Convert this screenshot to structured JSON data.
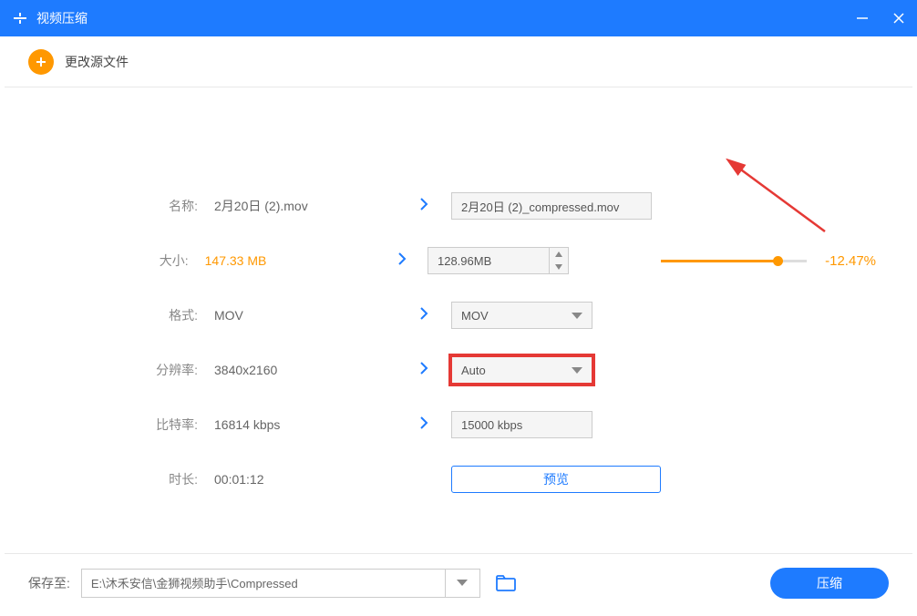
{
  "titlebar": {
    "title": "视频压缩"
  },
  "header": {
    "changeSource": "更改源文件"
  },
  "rows": {
    "name": {
      "label": "名称:",
      "source": "2月20日 (2).mov",
      "target": "2月20日 (2)_compressed.mov"
    },
    "size": {
      "label": "大小:",
      "source": "147.33 MB",
      "target": "128.96MB",
      "percent": "-12.47%"
    },
    "format": {
      "label": "格式:",
      "source": "MOV",
      "target": "MOV"
    },
    "resolution": {
      "label": "分辨率:",
      "source": "3840x2160",
      "target": "Auto"
    },
    "bitrate": {
      "label": "比特率:",
      "source": "16814 kbps",
      "target": "15000 kbps"
    },
    "duration": {
      "label": "时长:",
      "source": "00:01:12"
    }
  },
  "preview": "预览",
  "footer": {
    "saveTo": "保存至:",
    "path": "E:\\沐禾安信\\金狮视频助手\\Compressed",
    "compress": "压缩"
  }
}
